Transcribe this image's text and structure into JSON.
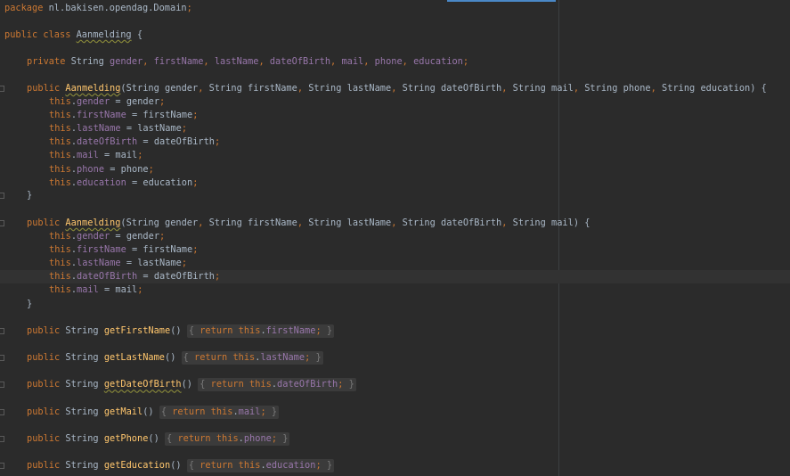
{
  "editor": {
    "package_line": {
      "keyword": "package",
      "name": "nl.bakisen.opendag.Domain",
      "semicolon": ";"
    },
    "class_decl": {
      "modifiers": "public class",
      "name": "Aanmelding",
      "brace": "{"
    },
    "fields_line": {
      "modifiers": "private",
      "type": "String",
      "fields": [
        "gender",
        "firstName",
        "lastName",
        "dateOfBirth",
        "mail",
        "phone",
        "education"
      ]
    },
    "constructor1": {
      "signature": "public Aanmelding(String gender, String firstName, String lastName, String dateOfBirth, String mail, String phone, String education) {",
      "assignments": [
        "this.gender = gender;",
        "this.firstName = firstName;",
        "this.lastName = lastName;",
        "this.dateOfBirth = dateOfBirth;",
        "this.mail = mail;",
        "this.phone = phone;",
        "this.education = education;"
      ],
      "close": "}"
    },
    "constructor2": {
      "signature": "public Aanmelding(String gender, String firstName, String lastName, String dateOfBirth, String mail) {",
      "assignments": [
        "this.gender = gender;",
        "this.firstName = firstName;",
        "this.lastName = lastName;",
        "this.dateOfBirth = dateOfBirth;",
        "this.mail = mail;"
      ],
      "close": "}"
    },
    "getters": [
      {
        "prefix": "public String",
        "name": "getFirstName",
        "body": "return this.firstName;"
      },
      {
        "prefix": "public String",
        "name": "getLastName",
        "body": "return this.lastName;"
      },
      {
        "prefix": "public String",
        "name": "getDateOfBirth",
        "body": "return this.dateOfBirth;"
      },
      {
        "prefix": "public String",
        "name": "getMail",
        "body": "return this.mail;"
      },
      {
        "prefix": "public String",
        "name": "getPhone",
        "body": "return this.phone;"
      },
      {
        "prefix": "public String",
        "name": "getEducation",
        "body": "return this.education;"
      }
    ]
  },
  "colors": {
    "background": "#2b2b2b",
    "keyword": "#cc7832",
    "field": "#9876aa",
    "method": "#ffc66d",
    "text": "#a9b7c6",
    "current_line": "#323232"
  }
}
